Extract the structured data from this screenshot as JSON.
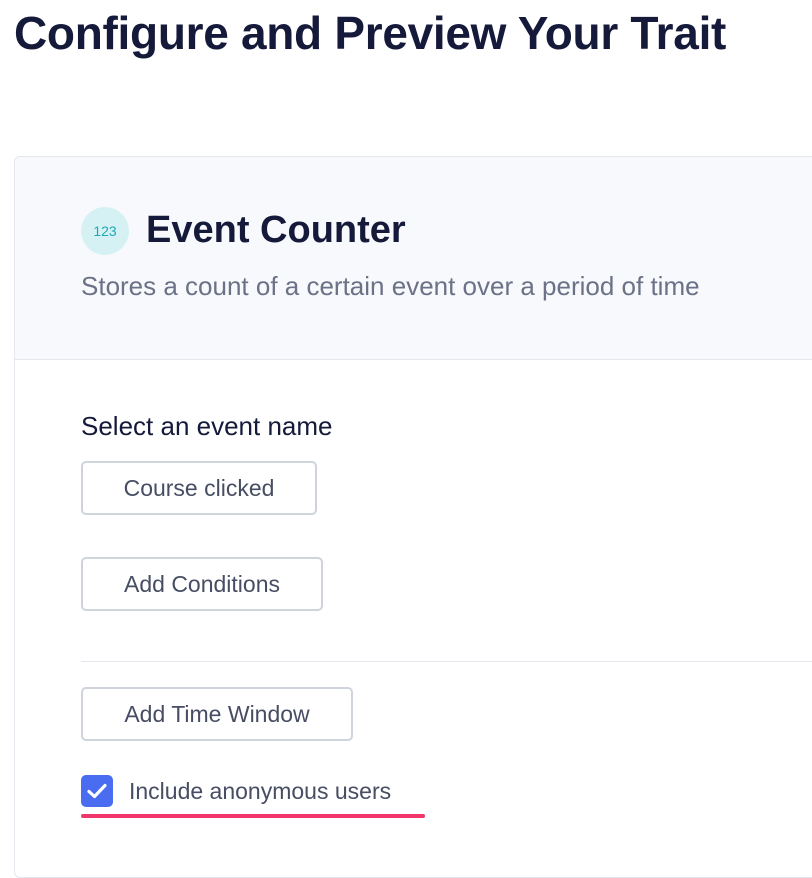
{
  "page": {
    "title": "Configure and Preview Your Trait"
  },
  "trait": {
    "badge": "123",
    "title": "Event Counter",
    "description": "Stores a count of a certain event over a period of time"
  },
  "event_section": {
    "label": "Select an event name",
    "selected_event": "Course clicked",
    "add_conditions_label": "Add Conditions",
    "add_time_window_label": "Add Time Window"
  },
  "options": {
    "include_anonymous": {
      "label": "Include anonymous users",
      "checked": true
    }
  },
  "colors": {
    "accent": "#4a6cf0",
    "highlight": "#f2366c",
    "badge_bg": "#d6f1f3",
    "badge_text": "#1fa7b8"
  },
  "icons": {
    "checkbox": "check-icon"
  }
}
